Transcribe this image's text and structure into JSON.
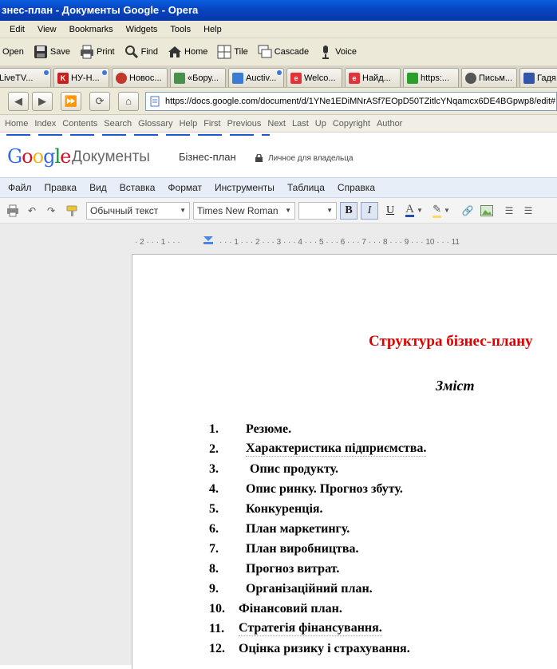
{
  "window": {
    "title": "знес-план - Документы Google - Opera"
  },
  "menubar": [
    "Edit",
    "View",
    "Bookmarks",
    "Widgets",
    "Tools",
    "Help"
  ],
  "toolbar": [
    {
      "label": "Open",
      "icon": "open-icon"
    },
    {
      "label": "Save",
      "icon": "save-icon"
    },
    {
      "label": "Print",
      "icon": "print-icon"
    },
    {
      "label": "Find",
      "icon": "find-icon"
    },
    {
      "label": "Home",
      "icon": "home-icon"
    },
    {
      "label": "Tile",
      "icon": "tile-icon"
    },
    {
      "label": "Cascade",
      "icon": "cascade-icon"
    },
    {
      "label": "Voice",
      "icon": "voice-icon"
    }
  ],
  "tabs": [
    {
      "label": "LiveTV...",
      "fav": "",
      "color": "#d4d0c0"
    },
    {
      "label": "НУ-Н...",
      "fav": "K",
      "color": "#cc1e1e"
    },
    {
      "label": "Новос...",
      "fav": "",
      "color": "#c0392b"
    },
    {
      "label": "«Бору...",
      "fav": "",
      "color": "#4a8f4a"
    },
    {
      "label": "Auctiv...",
      "fav": "",
      "color": "#3a7bd5"
    },
    {
      "label": "Welco...",
      "fav": "e",
      "color": "#e53238"
    },
    {
      "label": "Найд...",
      "fav": "e",
      "color": "#e53238"
    },
    {
      "label": "https:...",
      "fav": "",
      "color": "#2aa02a"
    },
    {
      "label": "Письм...",
      "fav": "",
      "color": "#555555"
    },
    {
      "label": "Гадя...",
      "fav": "",
      "color": "#3355aa"
    }
  ],
  "address": {
    "url": "https://docs.google.com/document/d/1YNe1EDiMNrASf7EOpD50TZitlcYNqamcx6DE4BGpwp8/edit#"
  },
  "gadgetbar": [
    "Home",
    "Index",
    "Contents",
    "Search",
    "Glossary",
    "Help",
    "First",
    "Previous",
    "Next",
    "Last",
    "Up",
    "Copyright",
    "Author"
  ],
  "docs": {
    "logo_suffix": "Документы",
    "title": "Бізнес-план",
    "access": "Личное для владельца",
    "menu": [
      "Файл",
      "Правка",
      "Вид",
      "Вставка",
      "Формат",
      "Инструменты",
      "Таблица",
      "Справка"
    ],
    "style_select": "Обычный текст",
    "font_select": "Times New Roman",
    "size_select": ""
  },
  "ruler": [
    "2",
    "1",
    "1",
    "2",
    "3",
    "4",
    "5",
    "6",
    "7",
    "8",
    "9",
    "10",
    "11"
  ],
  "document": {
    "heading": "Структура бізнес-плану",
    "subheading": "Зміст",
    "items": [
      {
        "num": "1.",
        "text": "Резюме."
      },
      {
        "num": "2.",
        "text": "Характеристика підприємства."
      },
      {
        "num": "3.",
        "text": " Опис продукту."
      },
      {
        "num": "4.",
        "text": "Опис ринку. Прогноз збуту."
      },
      {
        "num": "5.",
        "text": "Конкуренція."
      },
      {
        "num": "6.",
        "text": "План маркетингу."
      },
      {
        "num": "7.",
        "text": "План виробництва."
      },
      {
        "num": "8.",
        "text": "Прогноз витрат."
      },
      {
        "num": "9.",
        "text": "Організаційний план."
      },
      {
        "num": "10.",
        "text": "Фінансовий план."
      },
      {
        "num": "11.",
        "text": "Стратегія фінансування."
      },
      {
        "num": "12.",
        "text": "Оцінка ризику і страхування."
      }
    ]
  }
}
